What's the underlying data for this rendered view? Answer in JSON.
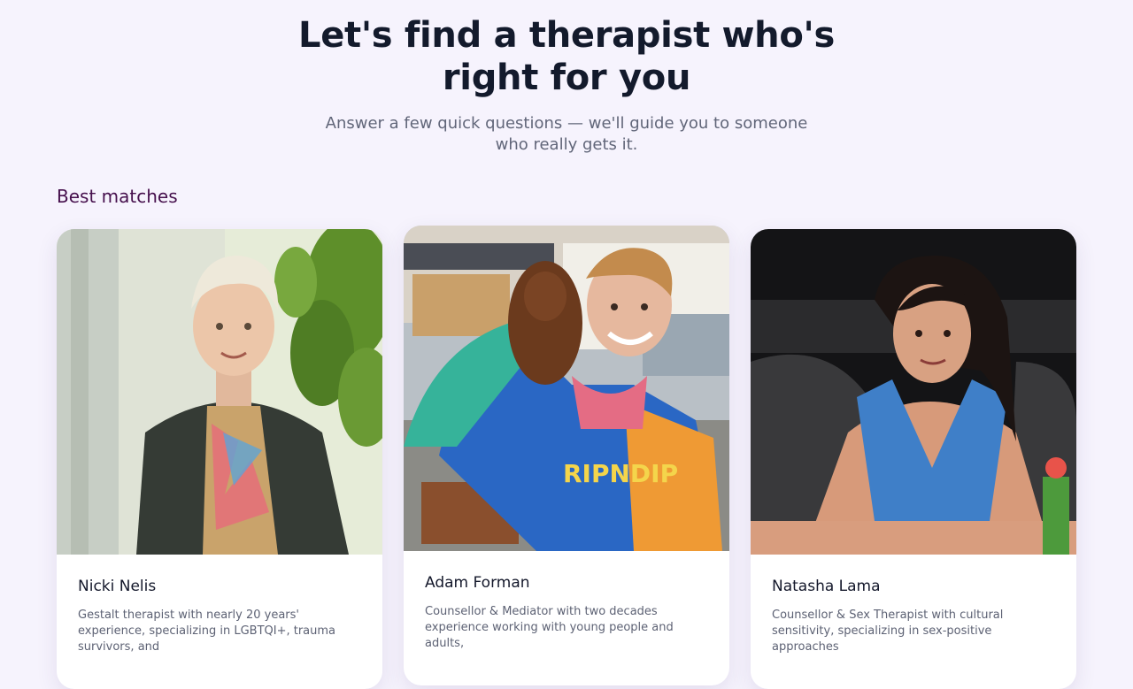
{
  "hero": {
    "title": "Let's find a therapist who's right for you",
    "subtitle": "Answer a few quick questions — we'll guide you to someone who really gets it."
  },
  "matches": {
    "heading": "Best matches",
    "cards": [
      {
        "name": "Nicki Nelis",
        "description": "Gestalt therapist with nearly 20 years' experience, specializing in LGBTQI+, trauma survivors, and"
      },
      {
        "name": "Adam Forman",
        "description": "Counsellor & Mediator with two decades experience working with young people and adults,"
      },
      {
        "name": "Natasha Lama",
        "description": "Counsellor & Sex Therapist with cultural sensitivity, specializing in sex-positive approaches"
      }
    ]
  },
  "colors": {
    "page_background": "#f6f3fd",
    "heading_accent": "#46104d",
    "title_text": "#131a2c",
    "muted_text": "#616679"
  }
}
